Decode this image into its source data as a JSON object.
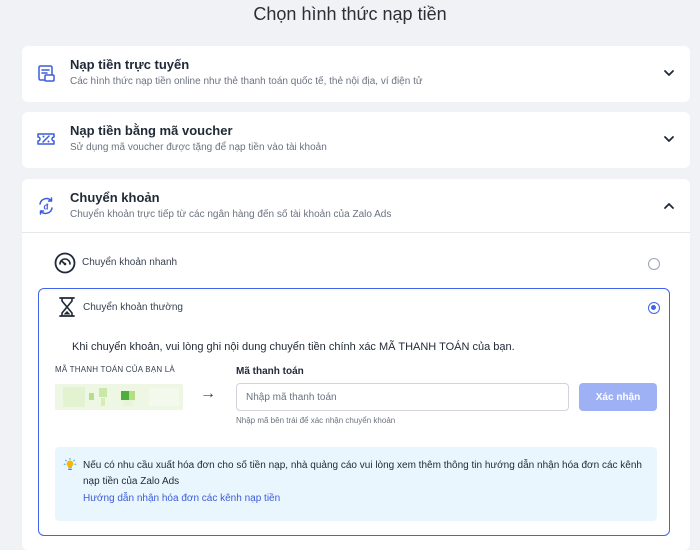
{
  "page": {
    "title": "Chọn hình thức nạp tiền"
  },
  "online": {
    "title": "Nạp tiền trực tuyến",
    "description": "Các hình thức nạp tiền online như thẻ thanh toán quốc tế, thẻ nội địa, ví điện tử",
    "icon": "online-payment-icon",
    "state": "collapsed"
  },
  "voucher": {
    "title": "Nạp tiền bằng mã voucher",
    "description": "Sử dụng mã voucher được tặng để nạp tiền vào tài khoản",
    "icon": "voucher-icon",
    "state": "collapsed"
  },
  "transfer": {
    "title": "Chuyển khoản",
    "description": "Chuyển khoản trực tiếp từ các ngân hàng đến số tài khoản của Zalo Ads",
    "icon": "bank-transfer-icon",
    "state": "expanded",
    "fast": {
      "label": "Chuyển khoản nhanh",
      "icon": "speedometer-icon",
      "selected": false
    },
    "normal": {
      "label": "Chuyển khoản thường",
      "icon": "hourglass-icon",
      "selected": true,
      "instruction": "Khi chuyển khoản, vui lòng ghi nội dung chuyển tiền chính xác MÃ THANH TOÁN của bạn.",
      "code_label": "MÃ THANH TOÁN CỦA BẠN LÀ",
      "arrow": "→",
      "field_label": "Mã thanh toán",
      "input_value": "",
      "input_placeholder": "Nhập mã thanh toán",
      "confirm_label": "Xác nhận",
      "hint": "Nhập mã bên trái để xác nhận chuyển khoản",
      "info_text": "Nếu có nhu cầu xuất hóa đơn cho số tiền nạp, nhà quảng cáo vui lòng xem thêm thông tin hướng dẫn nhận hóa đơn các kênh nạp tiền của Zalo Ads",
      "info_link": "Hướng dẫn nhận hóa đơn các kênh nạp tiền"
    }
  },
  "colors": {
    "accent": "#4263eb",
    "button_disabled": "#9fb1f5",
    "link": "#3b5bdb",
    "info_bg": "#eaf6fd",
    "page_bg": "#f0f2f5"
  }
}
